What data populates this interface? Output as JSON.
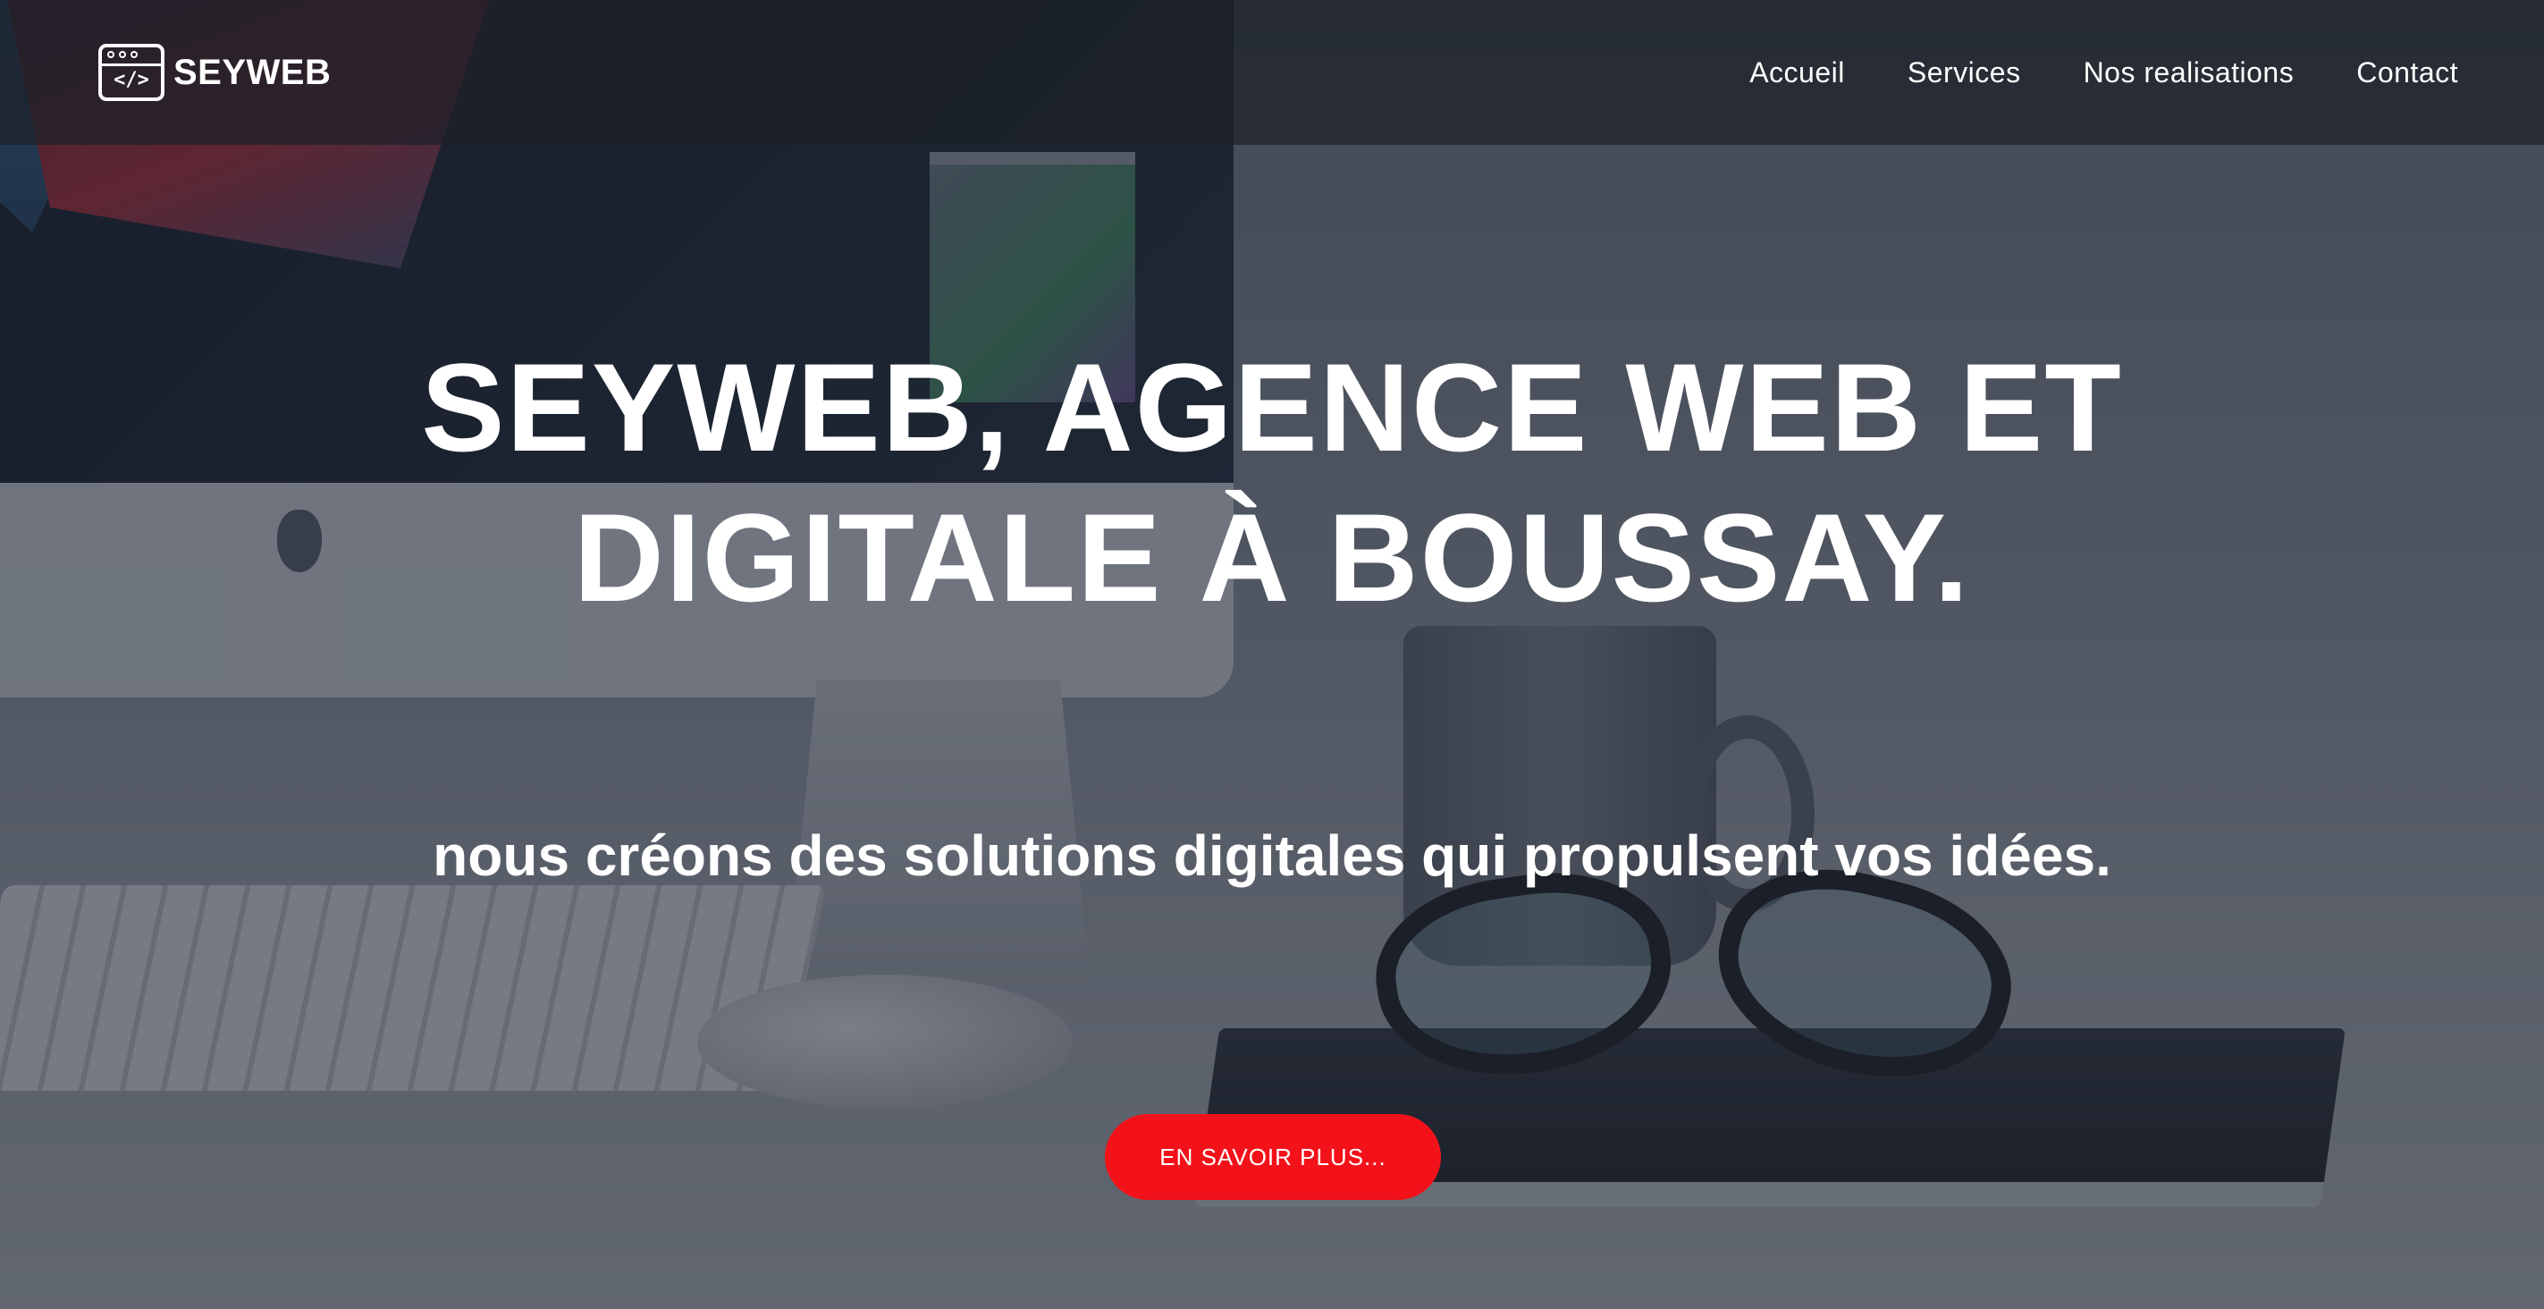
{
  "brand": {
    "name": "SEYWEB",
    "icon": "code-window-icon",
    "icon_glyph": "</>"
  },
  "nav": {
    "items": [
      {
        "label": "Accueil"
      },
      {
        "label": "Services"
      },
      {
        "label": "Nos realisations"
      },
      {
        "label": "Contact"
      }
    ]
  },
  "hero": {
    "title_line1": "SEYWEB, AGENCE WEB ET",
    "title_line2": "DIGITALE À BOUSSAY.",
    "subtitle": "nous créons des solutions digitales qui propulsent vos idées.",
    "cta_label": "EN SAVOIR PLUS..."
  },
  "colors": {
    "accent": "#f4121a",
    "navbar": "#1c2028",
    "text": "#ffffff"
  }
}
